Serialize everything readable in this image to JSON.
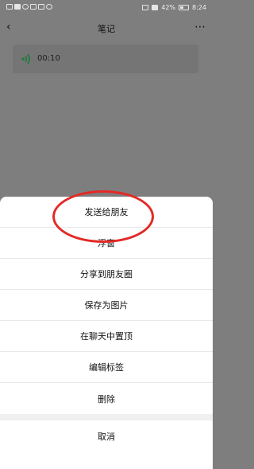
{
  "status_bar": {
    "battery_percent": "42%",
    "time": "8:24"
  },
  "header": {
    "back_icon": "‹",
    "title": "笔记",
    "more_icon": "⋯"
  },
  "note": {
    "voice_duration": "00:10"
  },
  "sheet": {
    "items": [
      {
        "label": "发送给朋友"
      },
      {
        "label": "浮窗"
      },
      {
        "label": "分享到朋友圈"
      },
      {
        "label": "保存为图片"
      },
      {
        "label": "在聊天中置顶"
      },
      {
        "label": "编辑标签"
      },
      {
        "label": "删除"
      }
    ],
    "cancel": "取消"
  }
}
